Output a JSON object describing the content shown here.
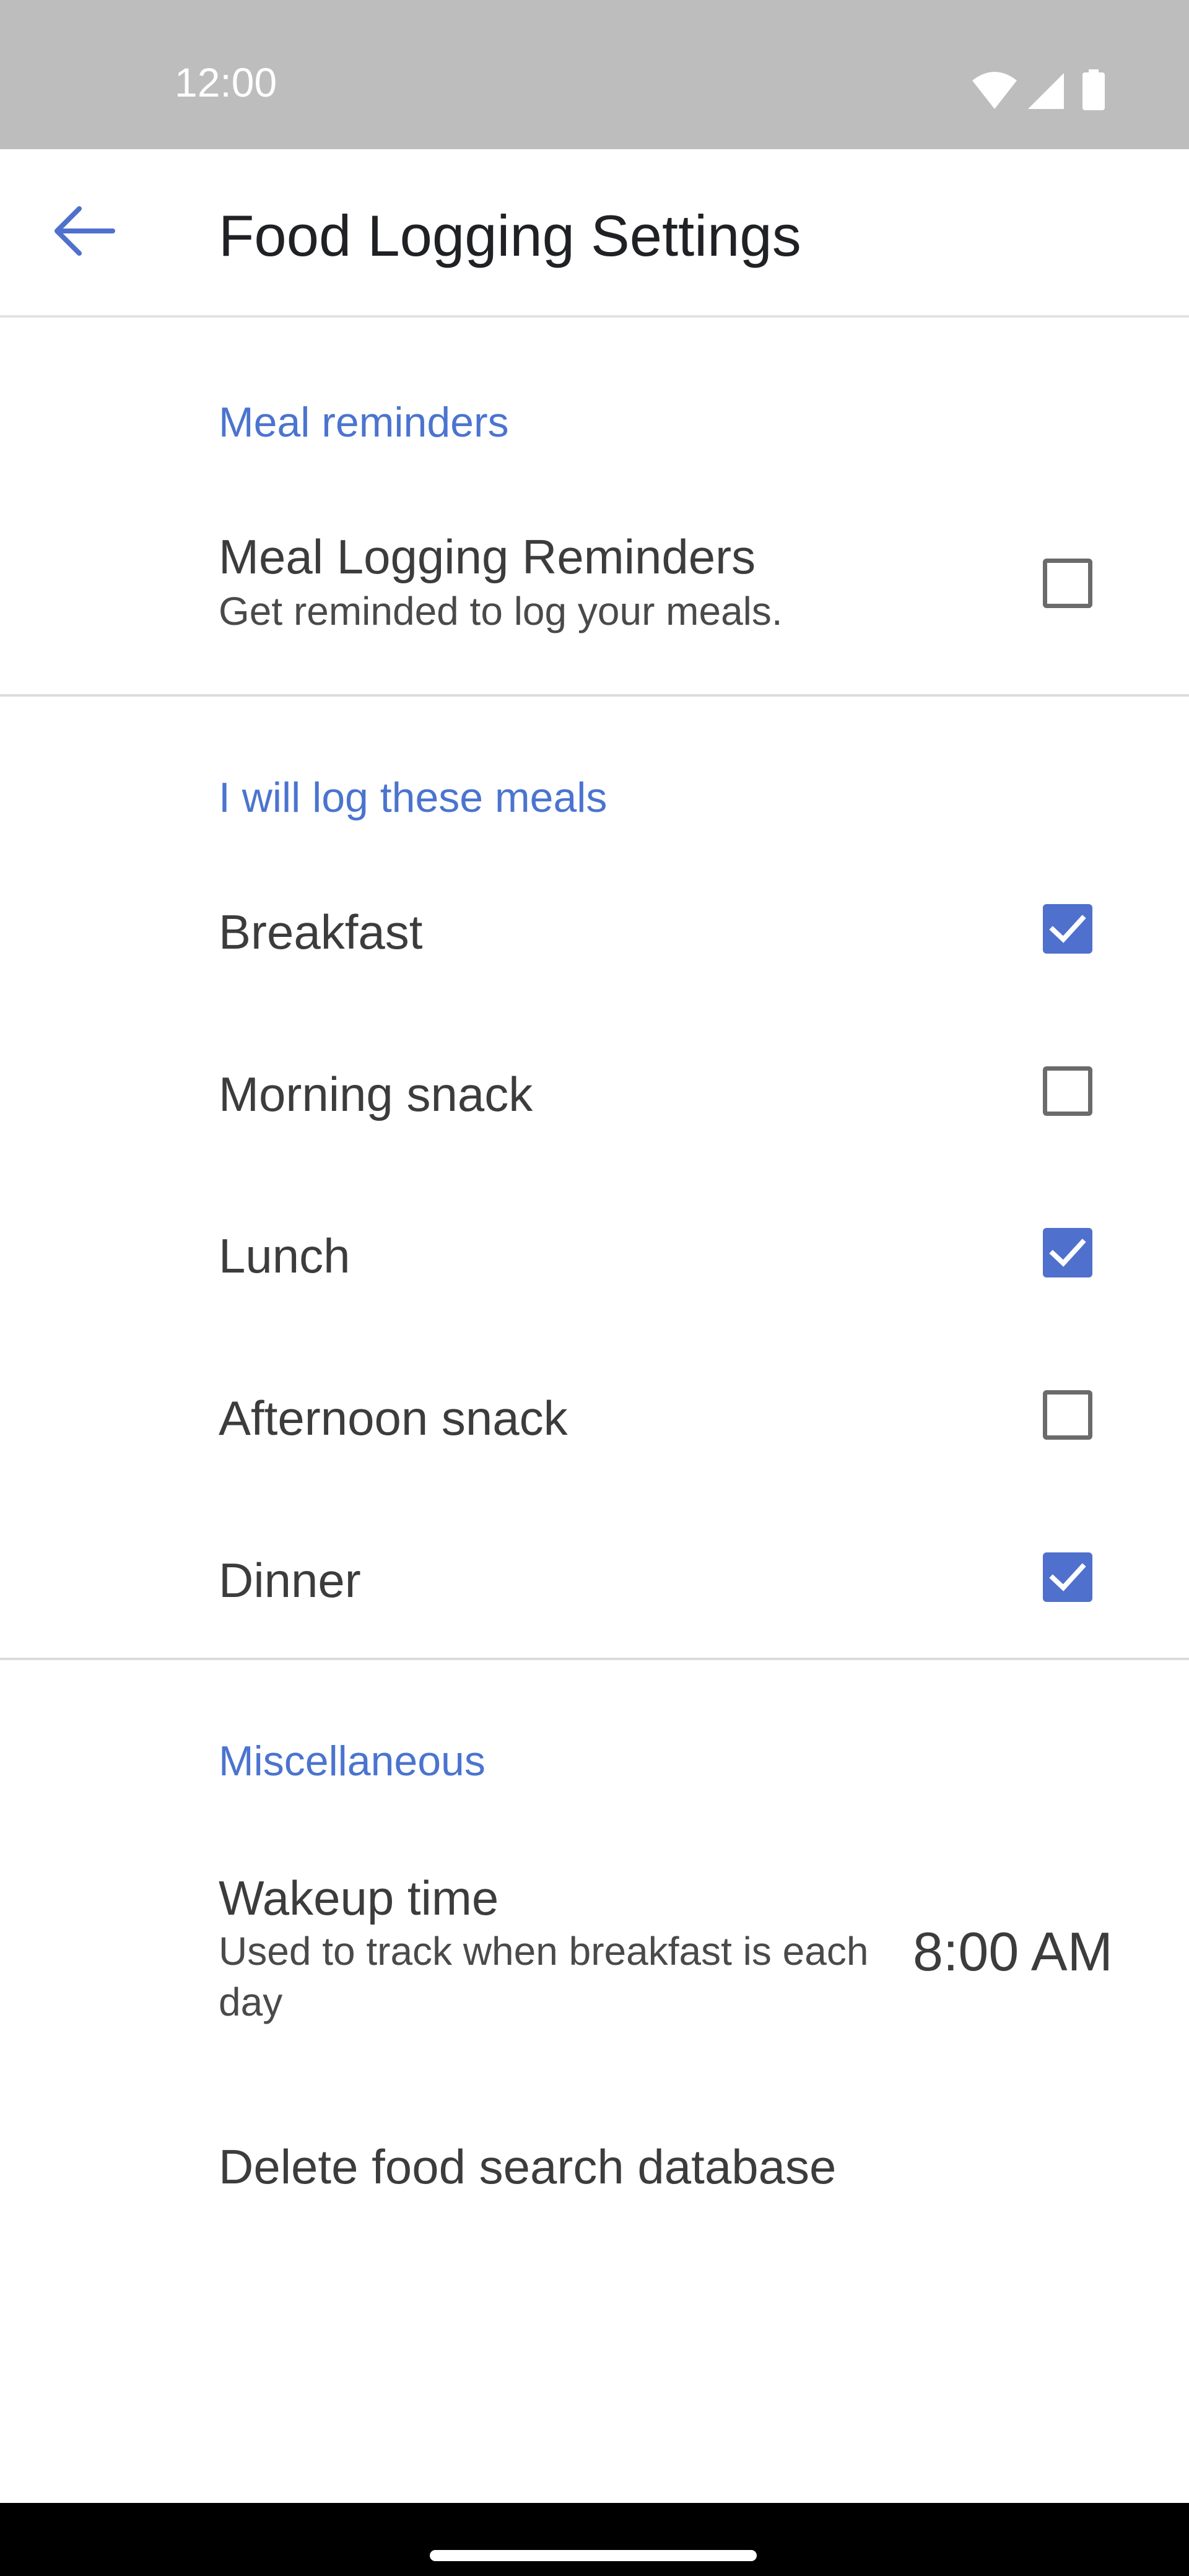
{
  "status_bar": {
    "time": "12:00",
    "icons": [
      "wifi-icon",
      "cellular-signal-icon",
      "battery-icon"
    ]
  },
  "app_bar": {
    "back_icon": "arrow-back-icon",
    "title": "Food Logging Settings"
  },
  "sections": {
    "reminders": {
      "header": "Meal reminders",
      "item": {
        "title": "Meal Logging Reminders",
        "summary": "Get reminded to log your meals.",
        "checked": false
      }
    },
    "meals": {
      "header": "I will log these meals",
      "items": [
        {
          "label": "Breakfast",
          "checked": true
        },
        {
          "label": "Morning snack",
          "checked": false
        },
        {
          "label": "Lunch",
          "checked": true
        },
        {
          "label": "Afternoon snack",
          "checked": false
        },
        {
          "label": "Dinner",
          "checked": true
        }
      ]
    },
    "misc": {
      "header": "Miscellaneous",
      "wakeup": {
        "title": "Wakeup time",
        "summary": "Used to track when breakfast is each day",
        "value": "8:00 AM"
      },
      "delete_db": {
        "title": "Delete food search database"
      }
    }
  },
  "colors": {
    "accent": "#4f70cc",
    "header_text": "#4b74cf",
    "status_bar": "#bdbdbd",
    "nav_bar": "#000000"
  }
}
